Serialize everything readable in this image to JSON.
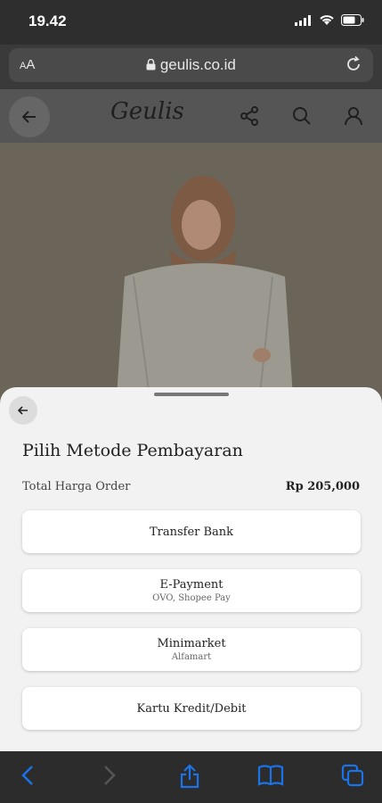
{
  "status": {
    "time": "19.42"
  },
  "browser": {
    "aa_small": "A",
    "aa_big": "A",
    "domain": "geulis.co.id"
  },
  "site": {
    "logo": "Geulis"
  },
  "sheet": {
    "title": "Pilih Metode Pembayaran",
    "total_label": "Total Harga Order",
    "total_value": "Rp 205,000",
    "options": [
      {
        "label": "Transfer Bank",
        "sub": ""
      },
      {
        "label": "E-Payment",
        "sub": "OVO, Shopee Pay"
      },
      {
        "label": "Minimarket",
        "sub": "Alfamart"
      },
      {
        "label": "Kartu Kredit/Debit",
        "sub": ""
      }
    ]
  },
  "colors": {
    "accent": "#1a73e8",
    "sheet_bg": "#f2f2f2"
  }
}
